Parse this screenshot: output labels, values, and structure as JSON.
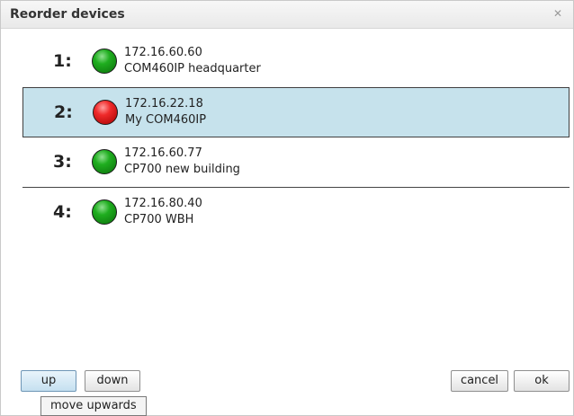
{
  "dialog": {
    "title": "Reorder devices",
    "close_icon": "close-icon"
  },
  "devices": [
    {
      "index": "1:",
      "ip": "172.16.60.60",
      "name": "COM460IP headquarter",
      "status": "green"
    },
    {
      "index": "2:",
      "ip": "172.16.22.18",
      "name": "My COM460IP",
      "status": "red",
      "selected": true
    },
    {
      "index": "3:",
      "ip": "172.16.60.77",
      "name": "CP700 new building",
      "status": "green"
    },
    {
      "index": "4:",
      "ip": "172.16.80.40",
      "name": "CP700 WBH",
      "status": "green"
    }
  ],
  "buttons": {
    "up": "up",
    "down": "down",
    "cancel": "cancel",
    "ok": "ok"
  },
  "tooltip": "move upwards",
  "colors": {
    "selected_row": "#c6e2ec",
    "status_green": "#1fae1f",
    "status_red": "#ef2a2a"
  }
}
